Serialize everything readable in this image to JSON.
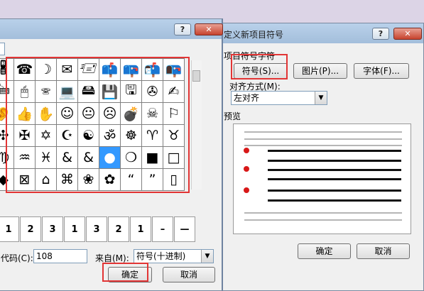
{
  "symbol_dialog": {
    "help_btn": "?",
    "close_btn": "✕",
    "symbols": [
      [
        "🖁",
        "☎",
        "☽",
        "✉",
        "🖅",
        "📫",
        "📪",
        "📬",
        "📭"
      ],
      [
        "🖮",
        "🖱",
        "🕾",
        "💻",
        "🖴",
        "💾",
        "🖫",
        "✇",
        "✍"
      ],
      [
        "👂",
        "👍",
        "✋",
        "☺",
        "😐",
        "☹",
        "💣",
        "☠",
        "⚐"
      ],
      [
        "✣",
        "✠",
        "✡",
        "☪",
        "☯",
        "ॐ",
        "☸",
        "♈",
        "♉"
      ],
      [
        "♍",
        "♒",
        "♓",
        "&",
        "&",
        "●",
        "❍",
        "■",
        "□"
      ],
      [
        "◆",
        "⊠",
        "⌂",
        "⌘",
        "❀",
        "✿",
        "“",
        "”",
        "▯"
      ]
    ],
    "recent_symbols": [
      "1",
      "2",
      "3",
      "1",
      "3",
      "2",
      "1",
      "–",
      "—"
    ],
    "char_code_label": "代码(C):",
    "char_code_value": "108",
    "from_label": "来自(M):",
    "from_value": "符号(十进制)",
    "ok_label": "确定",
    "cancel_label": "取消"
  },
  "bullet_dialog": {
    "title": "定义新项目符号",
    "help_btn": "?",
    "close_btn": "✕",
    "group_label": "项目符号字符",
    "symbol_btn": "符号(S)...",
    "picture_btn": "图片(P)...",
    "font_btn": "字体(F)...",
    "align_label": "对齐方式(M):",
    "align_value": "左对齐",
    "preview_label": "预览",
    "ok_label": "确定",
    "cancel_label": "取消"
  },
  "colors": {
    "highlight": "#e23535",
    "selected": "#3399ff",
    "bullet": "#d81818"
  }
}
